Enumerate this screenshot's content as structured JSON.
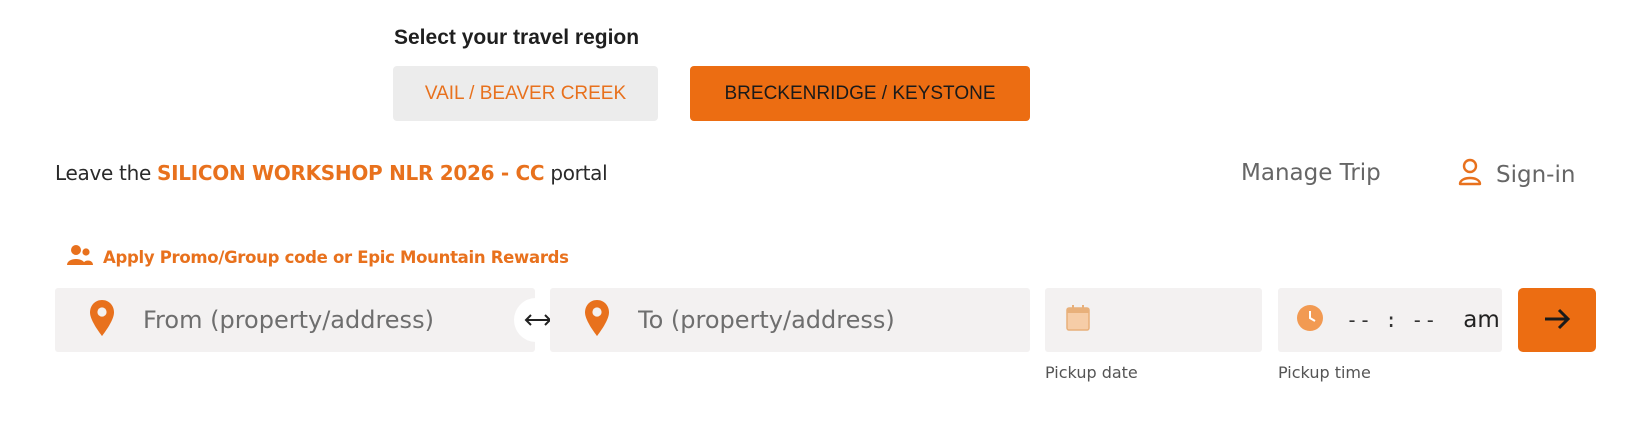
{
  "region": {
    "title": "Select your travel region",
    "options": [
      "VAIL / BEAVER CREEK",
      "BRECKENRIDGE / KEYSTONE"
    ],
    "selected": "BRECKENRIDGE / KEYSTONE"
  },
  "portal": {
    "prefix": "Leave the ",
    "event": "SILICON WORKSHOP NLR 2026 - CC",
    "suffix": " portal"
  },
  "nav": {
    "manage_trip": "Manage Trip",
    "sign_in": "Sign-in"
  },
  "promo": {
    "label": "Apply Promo/Group code or Epic Mountain Rewards"
  },
  "form": {
    "from_placeholder": "From (property/address)",
    "to_placeholder": "To (property/address)",
    "pickup_date_label": "Pickup date",
    "pickup_time_label": "Pickup time",
    "time_value": "-- : --",
    "ampm": "am"
  },
  "icons": {
    "location": "location-pin-icon",
    "swap": "swap-arrows-icon",
    "calendar": "calendar-icon",
    "clock": "clock-icon",
    "user": "user-icon",
    "group": "group-icon",
    "submit": "arrow-right-icon"
  },
  "colors": {
    "accent": "#ec6d12",
    "accent_text": "#e8711d",
    "field_bg": "#f3f1f1",
    "inactive_bg": "#ececec"
  }
}
